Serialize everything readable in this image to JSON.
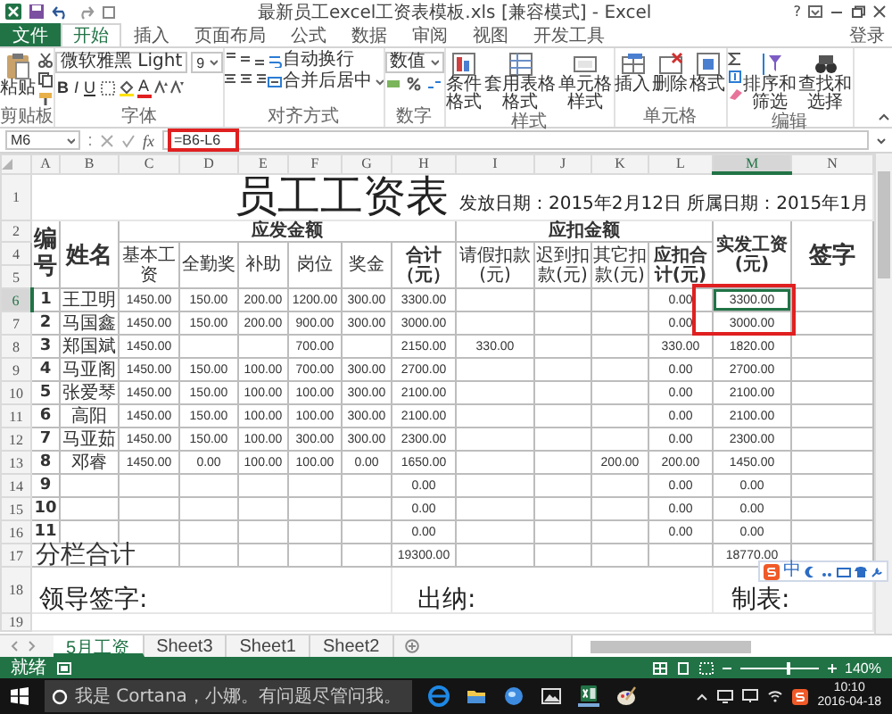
{
  "window": {
    "title": "最新员工excel工资表模板.xls [兼容模式] - Excel",
    "help": "?",
    "account": "登录"
  },
  "ribbon_tabs": [
    {
      "label": "文件",
      "kind": "file",
      "selected": false
    },
    {
      "label": "开始",
      "kind": "tab",
      "selected": true
    },
    {
      "label": "插入",
      "kind": "tab",
      "selected": false
    },
    {
      "label": "页面布局",
      "kind": "tab",
      "selected": false
    },
    {
      "label": "公式",
      "kind": "tab",
      "selected": false
    },
    {
      "label": "数据",
      "kind": "tab",
      "selected": false
    },
    {
      "label": "审阅",
      "kind": "tab",
      "selected": false
    },
    {
      "label": "视图",
      "kind": "tab",
      "selected": false
    },
    {
      "label": "开发工具",
      "kind": "tab",
      "selected": false
    }
  ],
  "ribbon_groups": [
    {
      "kind": "clipboard",
      "label": "剪贴板",
      "buttons": [
        "粘贴"
      ]
    },
    {
      "kind": "font",
      "label": "字体",
      "font_name": "微软雅黑 Light",
      "font_size": "9",
      "buttons": [
        "B",
        "I",
        "U",
        "A"
      ]
    },
    {
      "kind": "alignment",
      "label": "对齐方式",
      "buttons": [
        "自动换行",
        "合并后居中"
      ]
    },
    {
      "kind": "number",
      "label": "数字",
      "format": "数值"
    },
    {
      "kind": "styles",
      "label": "样式",
      "buttons": [
        "条件格式",
        "套用表格格式",
        "单元格样式"
      ]
    },
    {
      "kind": "cells",
      "label": "单元格",
      "buttons": [
        "插入",
        "删除",
        "格式"
      ]
    },
    {
      "kind": "editing",
      "label": "编辑",
      "buttons": [
        "排序和筛选",
        "查找和选择"
      ]
    }
  ],
  "formula_bar": {
    "name_box": "M6",
    "function_label": "fx",
    "formula": "=B6-L6"
  },
  "sheet": {
    "columns": [
      {
        "label": "A",
        "selected": false
      },
      {
        "label": "B",
        "selected": false
      },
      {
        "label": "C",
        "selected": false
      },
      {
        "label": "D",
        "selected": false
      },
      {
        "label": "E",
        "selected": false
      },
      {
        "label": "F",
        "selected": false
      },
      {
        "label": "G",
        "selected": false
      },
      {
        "label": "H",
        "selected": false
      },
      {
        "label": "I",
        "selected": false
      },
      {
        "label": "J",
        "selected": false
      },
      {
        "label": "K",
        "selected": false
      },
      {
        "label": "L",
        "selected": false
      },
      {
        "label": "M",
        "selected": true
      },
      {
        "label": "N",
        "selected": false
      }
    ],
    "title_row": {
      "header": "1",
      "title": "员工工资表",
      "subtitle": "发放日期：2015年2月12日 所属日期：2015年1月"
    },
    "header_rows": [
      "2",
      "4",
      "5"
    ],
    "header": {
      "number": "编号",
      "name": "姓名",
      "payable": "应发金额",
      "payable_items": [
        "基本工资",
        "全勤奖",
        "补助",
        "岗位",
        "奖金",
        "合计（元）"
      ],
      "deduction": "应扣金额",
      "deduction_items": [
        "请假扣款(元)",
        "迟到扣款(元)",
        "其它扣款(元)",
        "应扣合计(元)"
      ],
      "net": "实发工资(元)",
      "signature": "签字"
    },
    "rows": [
      {
        "header": "6",
        "selected": true,
        "cells": {
          "A": "1",
          "B": "王卫明",
          "C": "1450.00",
          "D": "150.00",
          "E": "200.00",
          "F": "1200.00",
          "G": "300.00",
          "H": "3300.00",
          "L": "0.00",
          "M": "3300.00"
        }
      },
      {
        "header": "7",
        "selected": false,
        "cells": {
          "A": "2",
          "B": "马国鑫",
          "C": "1450.00",
          "D": "150.00",
          "E": "200.00",
          "F": "900.00",
          "G": "300.00",
          "H": "3000.00",
          "L": "0.00",
          "M": "3000.00"
        }
      },
      {
        "header": "8",
        "selected": false,
        "cells": {
          "A": "3",
          "B": "郑国斌",
          "C": "1450.00",
          "F": "700.00",
          "H": "2150.00",
          "I": "330.00",
          "L": "330.00",
          "M": "1820.00"
        }
      },
      {
        "header": "9",
        "selected": false,
        "cells": {
          "A": "4",
          "B": "马亚阁",
          "C": "1450.00",
          "D": "150.00",
          "E": "100.00",
          "F": "700.00",
          "G": "300.00",
          "H": "2700.00",
          "L": "0.00",
          "M": "2700.00"
        }
      },
      {
        "header": "10",
        "selected": false,
        "cells": {
          "A": "5",
          "B": "张爱琴",
          "C": "1450.00",
          "D": "150.00",
          "E": "100.00",
          "F": "100.00",
          "G": "300.00",
          "H": "2100.00",
          "L": "0.00",
          "M": "2100.00"
        }
      },
      {
        "header": "11",
        "selected": false,
        "cells": {
          "A": "6",
          "B": "高阳",
          "C": "1450.00",
          "D": "150.00",
          "E": "100.00",
          "F": "100.00",
          "G": "300.00",
          "H": "2100.00",
          "L": "0.00",
          "M": "2100.00"
        }
      },
      {
        "header": "12",
        "selected": false,
        "cells": {
          "A": "7",
          "B": "马亚茹",
          "C": "1450.00",
          "D": "150.00",
          "E": "100.00",
          "F": "300.00",
          "G": "300.00",
          "H": "2300.00",
          "L": "0.00",
          "M": "2300.00"
        }
      },
      {
        "header": "13",
        "selected": false,
        "cells": {
          "A": "8",
          "B": "邓睿",
          "C": "1450.00",
          "D": "0.00",
          "E": "100.00",
          "F": "100.00",
          "G": "0.00",
          "H": "1650.00",
          "K": "200.00",
          "L": "200.00",
          "M": "1450.00"
        }
      },
      {
        "header": "14",
        "selected": false,
        "cells": {
          "A": "9",
          "H": "0.00",
          "L": "0.00",
          "M": "0.00"
        }
      },
      {
        "header": "15",
        "selected": false,
        "cells": {
          "A": "10",
          "H": "0.00",
          "L": "0.00",
          "M": "0.00"
        }
      },
      {
        "header": "16",
        "selected": false,
        "cells": {
          "A": "11",
          "H": "0.00",
          "L": "0.00",
          "M": "0.00"
        }
      }
    ],
    "total_row": {
      "header": "17",
      "label": "分栏合计",
      "cells": {
        "H": "19300.00",
        "M": "18770.00"
      }
    },
    "signature_row": {
      "header": "18",
      "items": [
        "领导签字:",
        "出纳:",
        "制表:"
      ]
    },
    "blank_rows": [
      "19"
    ]
  },
  "ime_toolbar": {
    "mode": "中"
  },
  "sheet_tabs": [
    {
      "label": "5月工资",
      "selected": true
    },
    {
      "label": "Sheet3",
      "selected": false
    },
    {
      "label": "Sheet1",
      "selected": false
    },
    {
      "label": "Sheet2",
      "selected": false
    }
  ],
  "status_bar": {
    "status": "就绪",
    "level": 0.62,
    "zoom": "140%"
  },
  "taskbar": {
    "search_placeholder": "我是 Cortana，小娜。有问题尽管问我。",
    "time": "10:10",
    "date": "2016-04-18"
  }
}
